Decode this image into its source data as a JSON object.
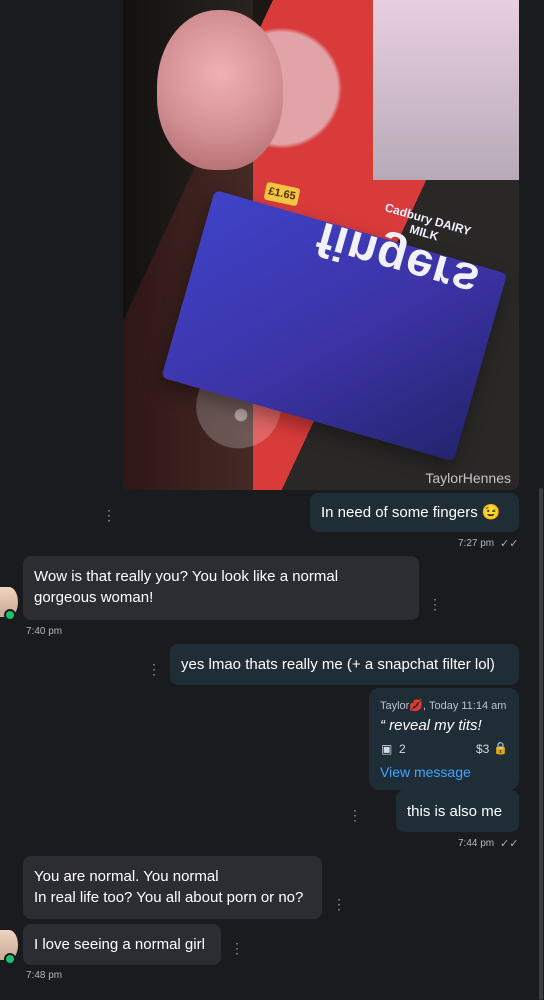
{
  "chat": {
    "photo": {
      "watermark": "TaylorHennes",
      "product_brand": "Cadbury DAIRY MILK",
      "product_name": "fingers",
      "price_tag": "£1.65"
    },
    "messages": [
      {
        "text": "In need of some fingers 😉",
        "time": "7:27 pm"
      },
      {
        "text": "Wow is that really you? You look like a normal gorgeous woman!",
        "time": "7:40 pm"
      },
      {
        "text": "yes lmao thats really me (+ a snapchat filter lol)"
      },
      {
        "card": {
          "sender": "Taylor",
          "sender_emoji": "💋",
          "meta": ", Today 11:14 am",
          "quote": "“ reveal my tits!",
          "image_count": "2",
          "price": "$3",
          "action": "View message"
        }
      },
      {
        "text": "this is also me",
        "time": "7:44 pm"
      },
      {
        "text": "You are normal. You normal\nIn real life too? You all about porn or no?"
      },
      {
        "text": "I love seeing a normal girl",
        "time": "7:48 pm"
      }
    ]
  },
  "icons": {
    "more": "⋮",
    "double_check": "✓✓",
    "image": "▣",
    "lock": "🔒"
  },
  "colors": {
    "background": "#1a1b1f",
    "outgoing_bubble": "#1f2d36",
    "incoming_bubble": "#2c2d33",
    "link": "#3da5ff",
    "online": "#19c26b"
  }
}
